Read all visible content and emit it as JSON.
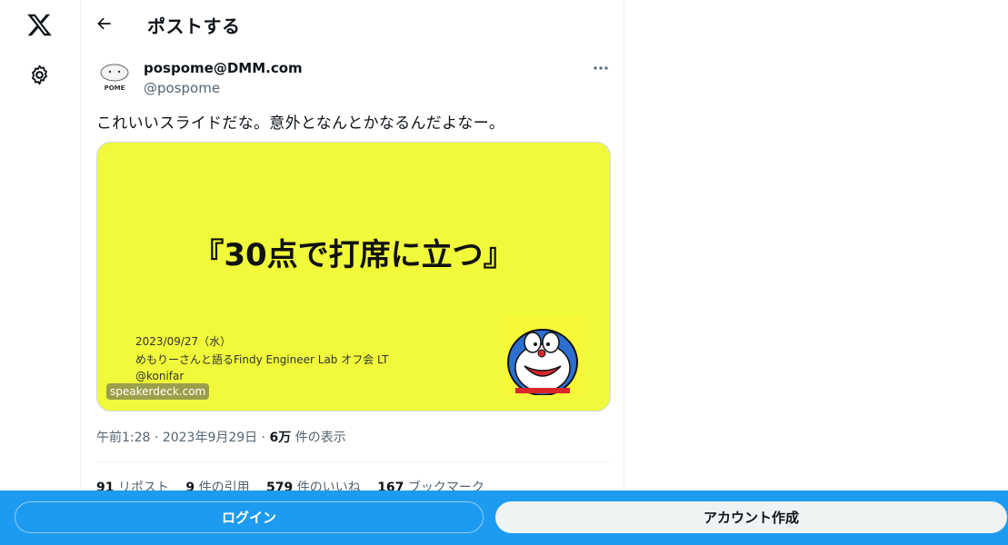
{
  "nav": {
    "logo_icon": "x-logo-icon",
    "settings_icon": "gear-icon"
  },
  "header": {
    "back_icon": "back-arrow-icon",
    "title": "ポストする"
  },
  "post": {
    "author_name": "pospome@DMM.com",
    "author_handle": "@pospome",
    "avatar_text": "POME",
    "more_icon": "more-dots-icon",
    "text": "これいいスライドだな。意外となんとかなるんだよなー。",
    "media": {
      "slide_title": "『30点で打席に立つ』",
      "date": "2023/09/27（水）",
      "event": "めもりーさんと語るFindy Engineer Lab オフ会 LT",
      "speaker": "@konifar",
      "source": "speakerdeck.com"
    },
    "time": "午前1:28",
    "date": "2023年9月29日",
    "views_count": "6万",
    "views_label": "件の表示",
    "stats": {
      "reposts_count": "91",
      "reposts_label": "リポスト",
      "quotes_count": "9",
      "quotes_label": "件の引用",
      "likes_count": "579",
      "likes_label": "件のいいね",
      "bookmarks_count": "167",
      "bookmarks_label": "ブックマーク"
    }
  },
  "bottom_bar": {
    "login_label": "ログイン",
    "signup_label": "アカウント作成",
    "color": "#1d9bf0"
  }
}
